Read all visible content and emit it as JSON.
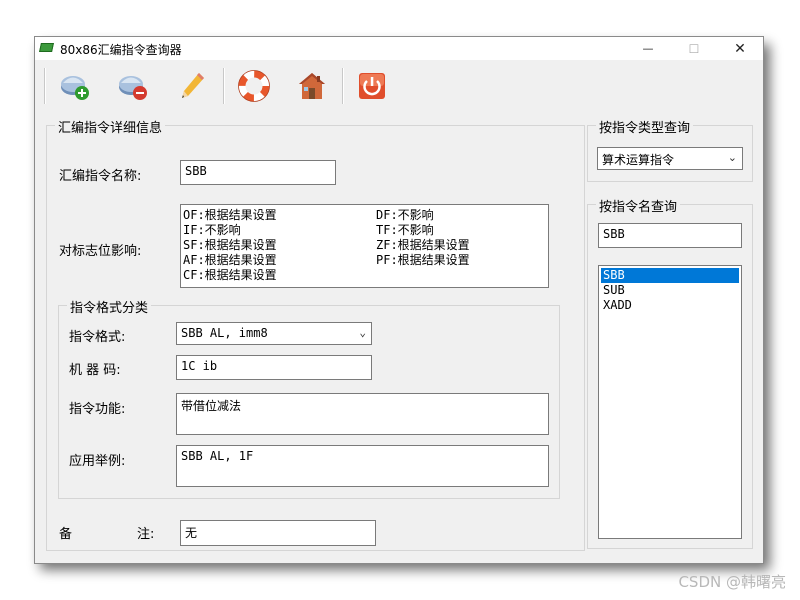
{
  "window": {
    "title": "80x86汇编指令查询器",
    "controls": {
      "minimize": "—",
      "maximize": "☐",
      "close": "✕"
    }
  },
  "toolbar": {
    "buttons": [
      {
        "name": "add-button",
        "icon": "add-record-icon"
      },
      {
        "name": "delete-button",
        "icon": "delete-record-icon"
      },
      {
        "name": "edit-button",
        "icon": "pencil-icon"
      },
      {
        "name": "help-button",
        "icon": "lifebuoy-icon"
      },
      {
        "name": "home-button",
        "icon": "house-icon"
      },
      {
        "name": "exit-button",
        "icon": "power-icon"
      }
    ]
  },
  "details": {
    "group_title": "汇编指令详细信息",
    "name_label": "汇编指令名称:",
    "name_value": "SBB",
    "flags_label": "对标志位影响:",
    "flags": [
      "OF:根据结果设置",
      "DF:不影响",
      "IF:不影响",
      "TF:不影响",
      "SF:根据结果设置",
      "ZF:根据结果设置",
      "AF:根据结果设置",
      "PF:根据结果设置",
      "CF:根据结果设置"
    ],
    "format_group_title": "指令格式分类",
    "format_label": "指令格式:",
    "format_value": "SBB AL, imm8",
    "machine_code_label": "机 器 码:",
    "machine_code_value": "1C ib",
    "function_label": "指令功能:",
    "function_value": "带借位减法",
    "example_label": "应用举例:",
    "example_value": "SBB AL, 1F",
    "remark_label_1": "备",
    "remark_label_2": "注:",
    "remark_value": "无"
  },
  "type_query": {
    "group_title": "按指令类型查询",
    "selected": "算术运算指令"
  },
  "name_query": {
    "group_title": "按指令名查询",
    "input_value": "SBB",
    "results": [
      "SBB",
      "SUB",
      "XADD"
    ],
    "selected_index": 0
  },
  "watermark": "CSDN @韩曙亮",
  "colors": {
    "selection": "#0078d7",
    "window_bg": "#f0f0f0",
    "exit_icon": "#e04e2c"
  }
}
